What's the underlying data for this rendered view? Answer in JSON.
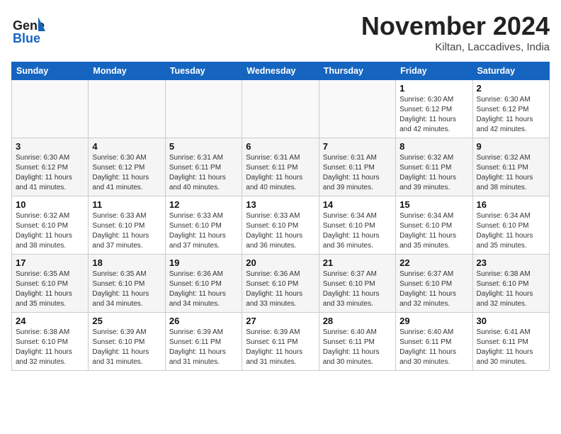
{
  "header": {
    "logo_general": "General",
    "logo_blue": "Blue",
    "month_title": "November 2024",
    "location": "Kiltan, Laccadives, India"
  },
  "weekdays": [
    "Sunday",
    "Monday",
    "Tuesday",
    "Wednesday",
    "Thursday",
    "Friday",
    "Saturday"
  ],
  "weeks": [
    [
      {
        "day": "",
        "info": ""
      },
      {
        "day": "",
        "info": ""
      },
      {
        "day": "",
        "info": ""
      },
      {
        "day": "",
        "info": ""
      },
      {
        "day": "",
        "info": ""
      },
      {
        "day": "1",
        "info": "Sunrise: 6:30 AM\nSunset: 6:12 PM\nDaylight: 11 hours\nand 42 minutes."
      },
      {
        "day": "2",
        "info": "Sunrise: 6:30 AM\nSunset: 6:12 PM\nDaylight: 11 hours\nand 42 minutes."
      }
    ],
    [
      {
        "day": "3",
        "info": "Sunrise: 6:30 AM\nSunset: 6:12 PM\nDaylight: 11 hours\nand 41 minutes."
      },
      {
        "day": "4",
        "info": "Sunrise: 6:30 AM\nSunset: 6:12 PM\nDaylight: 11 hours\nand 41 minutes."
      },
      {
        "day": "5",
        "info": "Sunrise: 6:31 AM\nSunset: 6:11 PM\nDaylight: 11 hours\nand 40 minutes."
      },
      {
        "day": "6",
        "info": "Sunrise: 6:31 AM\nSunset: 6:11 PM\nDaylight: 11 hours\nand 40 minutes."
      },
      {
        "day": "7",
        "info": "Sunrise: 6:31 AM\nSunset: 6:11 PM\nDaylight: 11 hours\nand 39 minutes."
      },
      {
        "day": "8",
        "info": "Sunrise: 6:32 AM\nSunset: 6:11 PM\nDaylight: 11 hours\nand 39 minutes."
      },
      {
        "day": "9",
        "info": "Sunrise: 6:32 AM\nSunset: 6:11 PM\nDaylight: 11 hours\nand 38 minutes."
      }
    ],
    [
      {
        "day": "10",
        "info": "Sunrise: 6:32 AM\nSunset: 6:10 PM\nDaylight: 11 hours\nand 38 minutes."
      },
      {
        "day": "11",
        "info": "Sunrise: 6:33 AM\nSunset: 6:10 PM\nDaylight: 11 hours\nand 37 minutes."
      },
      {
        "day": "12",
        "info": "Sunrise: 6:33 AM\nSunset: 6:10 PM\nDaylight: 11 hours\nand 37 minutes."
      },
      {
        "day": "13",
        "info": "Sunrise: 6:33 AM\nSunset: 6:10 PM\nDaylight: 11 hours\nand 36 minutes."
      },
      {
        "day": "14",
        "info": "Sunrise: 6:34 AM\nSunset: 6:10 PM\nDaylight: 11 hours\nand 36 minutes."
      },
      {
        "day": "15",
        "info": "Sunrise: 6:34 AM\nSunset: 6:10 PM\nDaylight: 11 hours\nand 35 minutes."
      },
      {
        "day": "16",
        "info": "Sunrise: 6:34 AM\nSunset: 6:10 PM\nDaylight: 11 hours\nand 35 minutes."
      }
    ],
    [
      {
        "day": "17",
        "info": "Sunrise: 6:35 AM\nSunset: 6:10 PM\nDaylight: 11 hours\nand 35 minutes."
      },
      {
        "day": "18",
        "info": "Sunrise: 6:35 AM\nSunset: 6:10 PM\nDaylight: 11 hours\nand 34 minutes."
      },
      {
        "day": "19",
        "info": "Sunrise: 6:36 AM\nSunset: 6:10 PM\nDaylight: 11 hours\nand 34 minutes."
      },
      {
        "day": "20",
        "info": "Sunrise: 6:36 AM\nSunset: 6:10 PM\nDaylight: 11 hours\nand 33 minutes."
      },
      {
        "day": "21",
        "info": "Sunrise: 6:37 AM\nSunset: 6:10 PM\nDaylight: 11 hours\nand 33 minutes."
      },
      {
        "day": "22",
        "info": "Sunrise: 6:37 AM\nSunset: 6:10 PM\nDaylight: 11 hours\nand 32 minutes."
      },
      {
        "day": "23",
        "info": "Sunrise: 6:38 AM\nSunset: 6:10 PM\nDaylight: 11 hours\nand 32 minutes."
      }
    ],
    [
      {
        "day": "24",
        "info": "Sunrise: 6:38 AM\nSunset: 6:10 PM\nDaylight: 11 hours\nand 32 minutes."
      },
      {
        "day": "25",
        "info": "Sunrise: 6:39 AM\nSunset: 6:10 PM\nDaylight: 11 hours\nand 31 minutes."
      },
      {
        "day": "26",
        "info": "Sunrise: 6:39 AM\nSunset: 6:11 PM\nDaylight: 11 hours\nand 31 minutes."
      },
      {
        "day": "27",
        "info": "Sunrise: 6:39 AM\nSunset: 6:11 PM\nDaylight: 11 hours\nand 31 minutes."
      },
      {
        "day": "28",
        "info": "Sunrise: 6:40 AM\nSunset: 6:11 PM\nDaylight: 11 hours\nand 30 minutes."
      },
      {
        "day": "29",
        "info": "Sunrise: 6:40 AM\nSunset: 6:11 PM\nDaylight: 11 hours\nand 30 minutes."
      },
      {
        "day": "30",
        "info": "Sunrise: 6:41 AM\nSunset: 6:11 PM\nDaylight: 11 hours\nand 30 minutes."
      }
    ]
  ]
}
